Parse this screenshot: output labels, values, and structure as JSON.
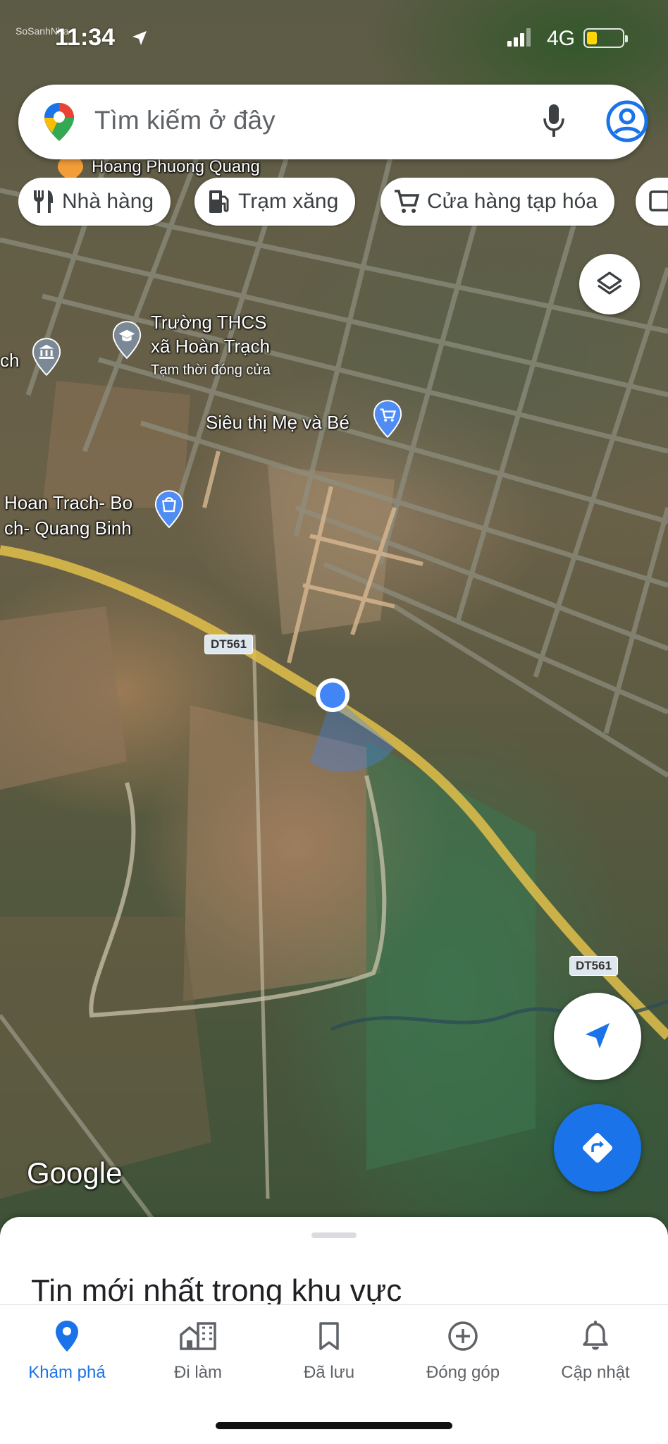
{
  "status_bar": {
    "time": "11:34",
    "network": "4G",
    "watermark": "SoSanhNha"
  },
  "search": {
    "placeholder": "Tìm kiếm ở đây",
    "mic_icon": "mic-icon",
    "account_icon": "account-circle-icon"
  },
  "chips": [
    {
      "label": "Nhà hàng",
      "icon": "restaurant-icon"
    },
    {
      "label": "Trạm xăng",
      "icon": "gas-station-icon"
    },
    {
      "label": "Cửa hàng tạp hóa",
      "icon": "shopping-cart-icon"
    }
  ],
  "map": {
    "labels": {
      "top_partial": "Hoang Phuong Quang",
      "school_line1": "Trường THCS",
      "school_line2": "xã Hoàn Trạch",
      "school_status": "Tạm thời đóng cửa",
      "left_partial": "ch",
      "supermarket": "Siêu thị Mẹ và Bé",
      "shop_line1": "Hoan Trach- Bo",
      "shop_line2": "ch- Quang Binh",
      "road_1": "DT561",
      "road_2": "DT561"
    },
    "logo": "Google",
    "colors": {
      "location_dot": "#4285f4",
      "poi_blue": "#4f8df5",
      "poi_gray": "#7b8896",
      "poi_orange": "#f29d38"
    }
  },
  "sheet": {
    "heading": "Tin mới nhất trong khu vực"
  },
  "tabs": [
    {
      "label": "Khám phá",
      "icon": "explore-pin-icon",
      "active": true
    },
    {
      "label": "Đi làm",
      "icon": "commute-icon",
      "active": false
    },
    {
      "label": "Đã lưu",
      "icon": "bookmark-icon",
      "active": false
    },
    {
      "label": "Đóng góp",
      "icon": "add-circle-icon",
      "active": false
    },
    {
      "label": "Cập nhật",
      "icon": "bell-icon",
      "active": false
    }
  ],
  "theme": {
    "accent": "#1a73e8",
    "text_muted": "#5f6368"
  }
}
